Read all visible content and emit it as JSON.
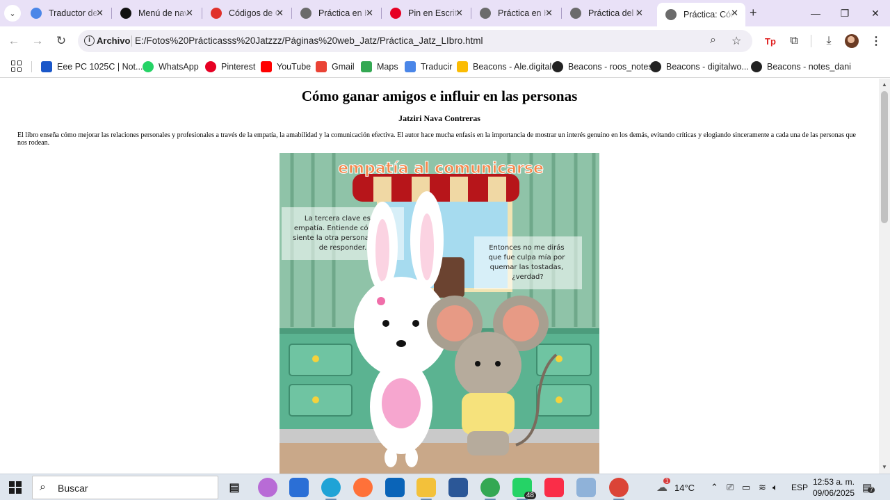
{
  "tabs": [
    {
      "title": "Traductor de Google",
      "favicon": "google-translate-icon",
      "color": "#4a86e8",
      "active": false
    },
    {
      "title": "Menú de navegación",
      "favicon": "threads-icon",
      "color": "#111111",
      "active": false
    },
    {
      "title": "Códigos de Colores",
      "favicon": "opera-icon",
      "color": "#e0312b",
      "active": false
    },
    {
      "title": "Práctica en HTML",
      "favicon": "globe-icon",
      "color": "#6b6b6b",
      "active": false
    },
    {
      "title": "Pin en Escritorio",
      "favicon": "pinterest-icon",
      "color": "#e60023",
      "active": false
    },
    {
      "title": "Práctica en HTML",
      "favicon": "globe-icon",
      "color": "#6b6b6b",
      "active": false
    },
    {
      "title": "Práctica del libro",
      "favicon": "globe-icon",
      "color": "#6b6b6b",
      "active": false
    },
    {
      "title": "Práctica: Cómo ganar",
      "favicon": "globe-icon",
      "color": "#6b6b6b",
      "active": true
    }
  ],
  "toolbar": {
    "chip": "Archivo",
    "url": "E:/Fotos%20Prácticasss%20Jatzzz/Páginas%20web_Jatz/Práctica_Jatz_LIbro.html"
  },
  "bookmarks": [
    {
      "label": "Eee PC 1025C | Not...",
      "icon": "asus-icon",
      "color": "#1a57c9"
    },
    {
      "label": "WhatsApp",
      "icon": "whatsapp-icon",
      "color": "#25d366"
    },
    {
      "label": "Pinterest",
      "icon": "pinterest-icon",
      "color": "#e60023"
    },
    {
      "label": "YouTube",
      "icon": "youtube-icon",
      "color": "#ff0000"
    },
    {
      "label": "Gmail",
      "icon": "gmail-icon",
      "color": "#ea4335"
    },
    {
      "label": "Maps",
      "icon": "maps-icon",
      "color": "#34a853"
    },
    {
      "label": "Traducir",
      "icon": "google-translate-icon",
      "color": "#4a86e8"
    },
    {
      "label": "Beacons - Ale.digital",
      "icon": "google-drive-icon",
      "color": "#fbbc04"
    },
    {
      "label": "Beacons - roos_notes",
      "icon": "beacons-icon",
      "color": "#222222"
    },
    {
      "label": "Beacons - digitalwo...",
      "icon": "beacons-icon",
      "color": "#222222"
    },
    {
      "label": "Beacons - notes_dani",
      "icon": "beacons-icon",
      "color": "#222222"
    }
  ],
  "page": {
    "title": "Cómo ganar amigos e influir en las personas",
    "author": "Jatziri Nava Contreras",
    "paragraph": "El libro enseña cómo mejorar las relaciones personales y profesionales a través de la empatía, la amabilidad y la comunicación efectiva. El autor hace mucha enfasis en la importancia de mostrar un interés genuino en los demás, evitando críticas y elogiando sinceramente a cada una de las personas que nos rodean.",
    "image": {
      "heading": "empatía al comunicarse",
      "bubble_left": [
        "La tercera clave es la",
        "empatía. Entiende cómo se",
        "siente la otra persona antes",
        "de responder."
      ],
      "bubble_right": [
        "Entonces no me dirás",
        "que fue culpa mía por",
        "quemar las tostadas,",
        "¿verdad?"
      ]
    }
  },
  "taskbar": {
    "search_label": "Buscar",
    "apps": [
      {
        "name": "task-view-icon",
        "color": "#dfe6ee"
      },
      {
        "name": "copilot-icon",
        "color": "#b86bd6"
      },
      {
        "name": "microsoft-store-icon",
        "color": "#2b6fd6"
      },
      {
        "name": "edge-icon",
        "color": "#1fa3d6"
      },
      {
        "name": "firefox-icon",
        "color": "#ff7139"
      },
      {
        "name": "outlook-icon",
        "color": "#0a64b8"
      },
      {
        "name": "file-explorer-icon",
        "color": "#f3c13a"
      },
      {
        "name": "word-icon",
        "color": "#2b5797"
      },
      {
        "name": "chrome-icon",
        "color": "#34a853"
      },
      {
        "name": "whatsapp-icon",
        "color": "#25d366",
        "badge": "48"
      },
      {
        "name": "itunes-icon",
        "color": "#fa2d48"
      },
      {
        "name": "photos-icon",
        "color": "#8fb2d9"
      },
      {
        "name": "chrome-profile-icon",
        "color": "#db4437"
      }
    ],
    "weather_temp": "14°C",
    "weather_badge": "1",
    "language": "ESP",
    "time": "12:53 a. m.",
    "date": "09/06/2025",
    "notification_count": "7"
  }
}
